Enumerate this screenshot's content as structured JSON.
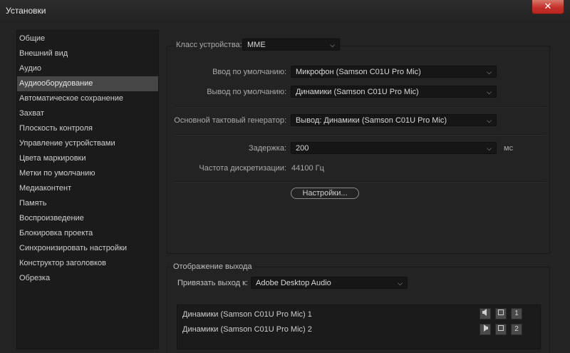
{
  "window": {
    "title": "Установки",
    "close_glyph": "✕"
  },
  "sidebar": {
    "items": [
      {
        "label": "Общие"
      },
      {
        "label": "Внешний вид"
      },
      {
        "label": "Аудио"
      },
      {
        "label": "Аудиооборудование",
        "selected": true
      },
      {
        "label": "Автоматическое сохранение"
      },
      {
        "label": "Захват"
      },
      {
        "label": "Плоскость контроля"
      },
      {
        "label": "Управление устройствами"
      },
      {
        "label": "Цвета маркировки"
      },
      {
        "label": "Метки по умолчанию"
      },
      {
        "label": "Медиаконтент"
      },
      {
        "label": "Память"
      },
      {
        "label": "Воспроизведение"
      },
      {
        "label": "Блокировка проекта"
      },
      {
        "label": "Синхронизировать настройки"
      },
      {
        "label": "Конструктор заголовков"
      },
      {
        "label": "Обрезка"
      }
    ]
  },
  "device": {
    "class_label": "Класс устройства:",
    "class_value": "MME",
    "default_input_label": "Ввод по умолчанию:",
    "default_input_value": "Микрофон (Samson C01U Pro Mic)",
    "default_output_label": "Вывод по умолчанию:",
    "default_output_value": "Динамики (Samson C01U Pro Mic)",
    "master_clock_label": "Основной тактовый генератор:",
    "master_clock_value": "Вывод: Динамики (Samson C01U Pro Mic)",
    "latency_label": "Задержка:",
    "latency_value": "200",
    "latency_unit": "мс",
    "sample_rate_label": "Частота дискретизации:",
    "sample_rate_value": "44100 Гц",
    "settings_button": "Настройки..."
  },
  "output_mapping": {
    "section_label": "Отображение выхода",
    "map_output_label": "Привязать выход к:",
    "map_output_value": "Adobe Desktop Audio",
    "channels": [
      {
        "label": "Динамики (Samson C01U Pro Mic) 1",
        "number": "1",
        "icon": "speaker-left-icon"
      },
      {
        "label": "Динамики (Samson C01U Pro Mic) 2",
        "number": "2",
        "icon": "speaker-right-icon"
      }
    ]
  },
  "icons": {
    "chevron": "chevron-down-icon"
  }
}
